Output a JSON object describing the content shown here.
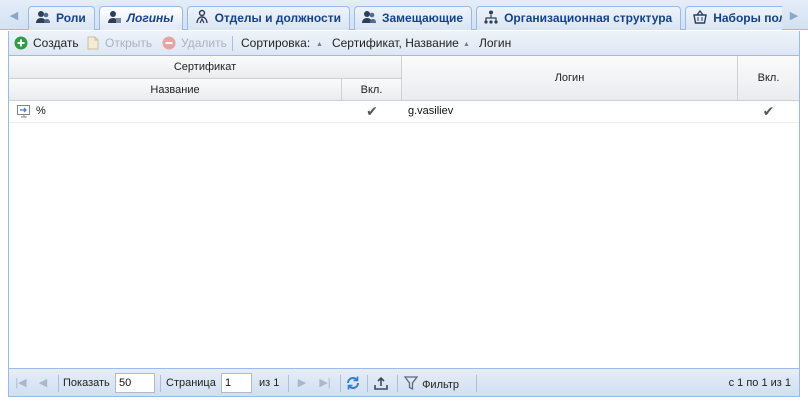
{
  "tabs": [
    {
      "label": "Роли",
      "icon": "users-icon"
    },
    {
      "label": "Логины",
      "icon": "user-login-icon",
      "active": true
    },
    {
      "label": "Отделы и должности",
      "icon": "departments-icon"
    },
    {
      "label": "Замещающие",
      "icon": "deputies-icon"
    },
    {
      "label": "Организационная структура",
      "icon": "org-structure-icon"
    },
    {
      "label": "Наборы полн",
      "icon": "basket-icon"
    }
  ],
  "toolbar": {
    "create_label": "Создать",
    "open_label": "Открыть",
    "delete_label": "Удалить",
    "sort_label": "Сортировка:",
    "sort_items": [
      "Сертификат, Название",
      "Логин"
    ]
  },
  "grid": {
    "group_header": "Сертификат",
    "columns": {
      "name": "Название",
      "cert_enabled": "Вкл.",
      "login": "Логин",
      "login_enabled": "Вкл."
    },
    "rows": [
      {
        "name": "%",
        "cert_enabled": "✔",
        "login": "g.vasiliev",
        "login_enabled": "✔"
      }
    ]
  },
  "pager": {
    "show_label": "Показать",
    "page_size": "50",
    "page_label": "Страница",
    "page": "1",
    "of_label": "из 1",
    "filter_label": "Фильтр",
    "summary": "с 1 по 1 из 1"
  },
  "colors": {
    "accent": "#15428b",
    "border": "#99bbe8",
    "create_green": "#2e9e45"
  }
}
